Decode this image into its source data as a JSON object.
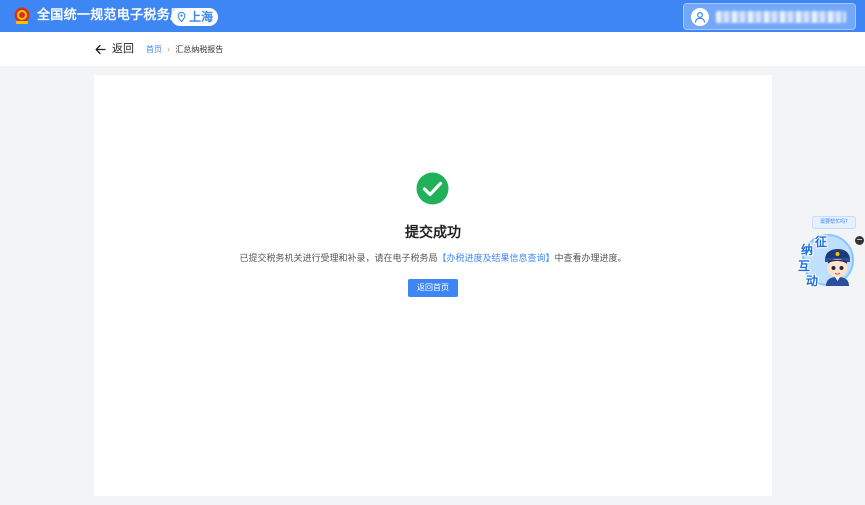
{
  "header": {
    "title": "全国统一规范电子税务局",
    "region": "上海",
    "user_name": "███████████████"
  },
  "subnav": {
    "back_label": "返回",
    "breadcrumb": {
      "home": "首页",
      "separator": "›",
      "current": "汇总纳税报告"
    }
  },
  "result": {
    "title": "提交成功",
    "desc_prefix": "已提交税务机关进行受理和补录，请在电子税务局",
    "desc_link": "【办税进度及结果信息查询】",
    "desc_suffix": "中查看办理进度。",
    "home_button": "返回首页"
  },
  "assistant": {
    "bubble": "需要帮忙吗?",
    "close": "−",
    "chars": [
      "征",
      "纳",
      "互",
      "动"
    ]
  },
  "colors": {
    "brand": "#3f86f5",
    "success": "#20b15a",
    "background": "#f3f4f6"
  },
  "icons": {
    "emblem": "national-emblem-icon",
    "region": "location-pin-icon",
    "avatar": "user-icon",
    "back": "arrow-left-icon",
    "success": "check-circle-icon"
  }
}
